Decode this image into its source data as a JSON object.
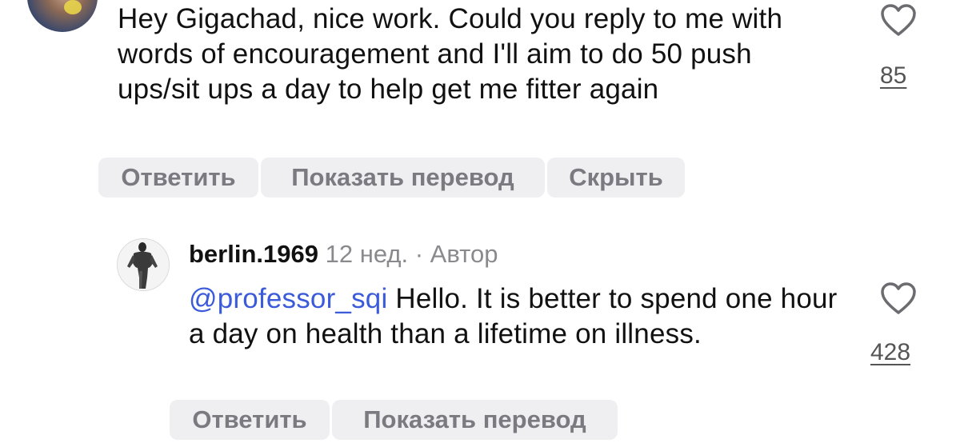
{
  "top_comment": {
    "text": "Hey Gigachad, nice work. Could you reply to me with words of encouragement and I'll aim to do 50 push ups/sit ups a day to help get me fitter again",
    "likes": "85",
    "actions": {
      "reply": "Ответить",
      "translate": "Показать перевод",
      "hide": "Скрыть"
    }
  },
  "reply_comment": {
    "username": "berlin.1969",
    "age": "12 нед.",
    "separator": "·",
    "author_badge": "Автор",
    "mention": "@professor_sqi",
    "text": " Hello. It is better to spend one hour a day on health than a lifetime on illness.",
    "likes": "428",
    "actions": {
      "reply": "Ответить",
      "translate": "Показать перевод"
    }
  },
  "icons": {
    "like": "heart-outline-icon"
  }
}
